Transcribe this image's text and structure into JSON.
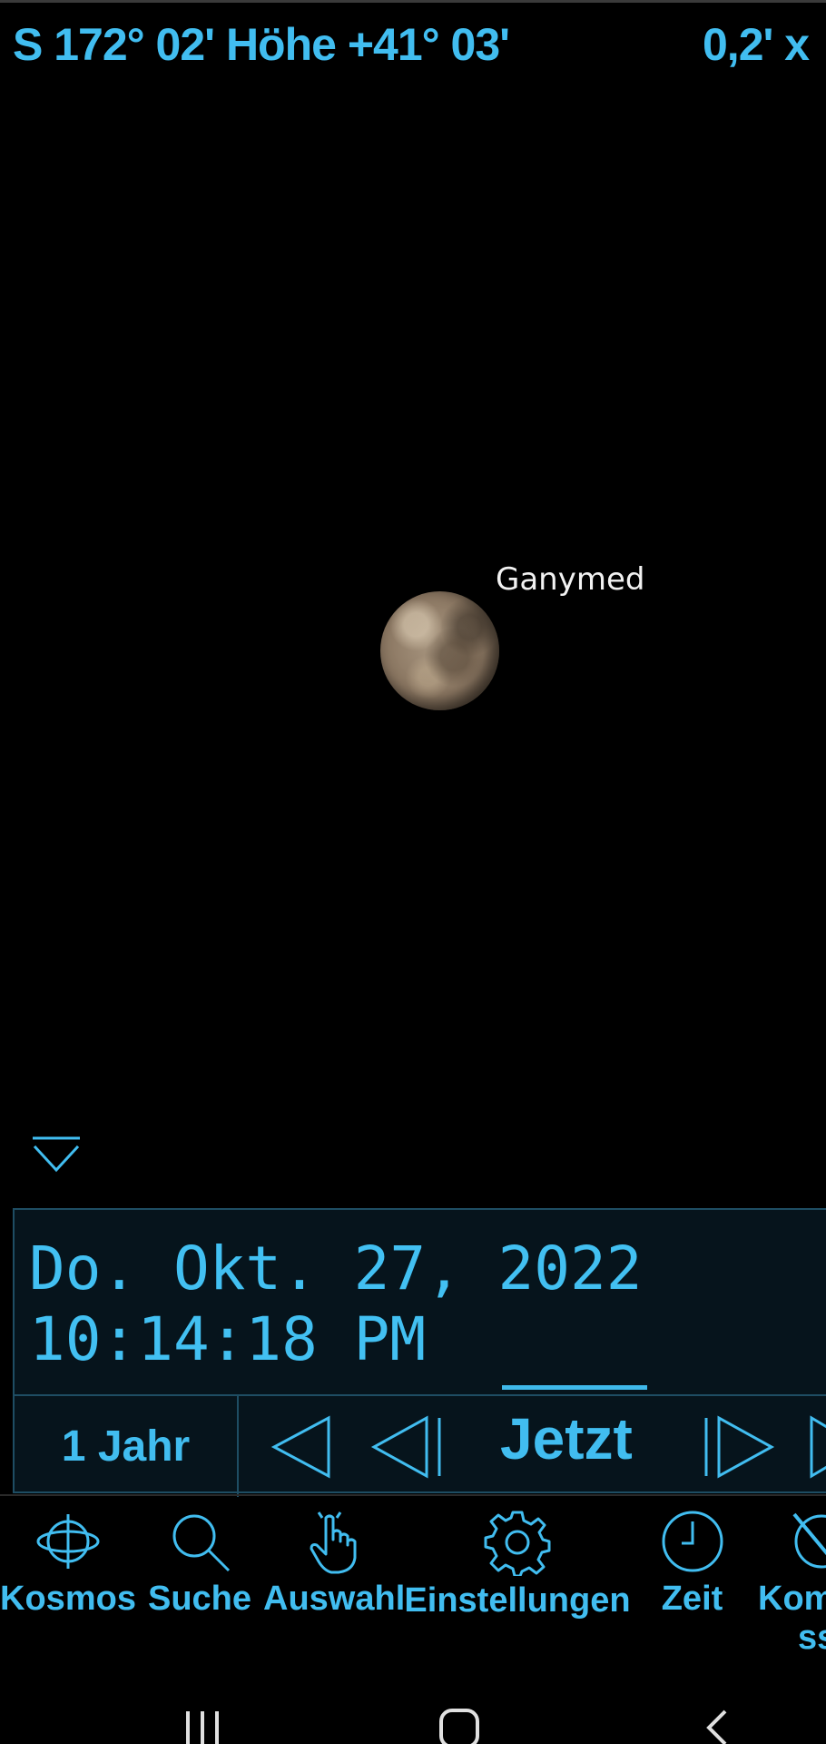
{
  "status": {
    "heading": "S  172° 02' Höhe +41° 03'",
    "zoom": "0,2' x"
  },
  "sky": {
    "object_label": "Ganymed"
  },
  "time_panel": {
    "date": "Do. Okt. 27, 2022",
    "time": "10:14:18 PM",
    "step_label": "1 Jahr",
    "now_label": "Jetzt"
  },
  "nav": {
    "items": [
      {
        "label": "Kosmos",
        "icon": "orbit-icon"
      },
      {
        "label": "Suche",
        "icon": "search-icon"
      },
      {
        "label": "Auswahl",
        "icon": "hand-pointer-icon"
      },
      {
        "label": "Einstellungen",
        "icon": "gear-icon"
      },
      {
        "label": "Zeit",
        "icon": "clock-icon"
      },
      {
        "label": "Kom",
        "label_line2": "ss",
        "icon": "compass-icon"
      }
    ]
  },
  "colors": {
    "accent": "#41bdf0",
    "panel_bg": "#06141c",
    "panel_border": "#1e4d63",
    "background": "#000000"
  }
}
